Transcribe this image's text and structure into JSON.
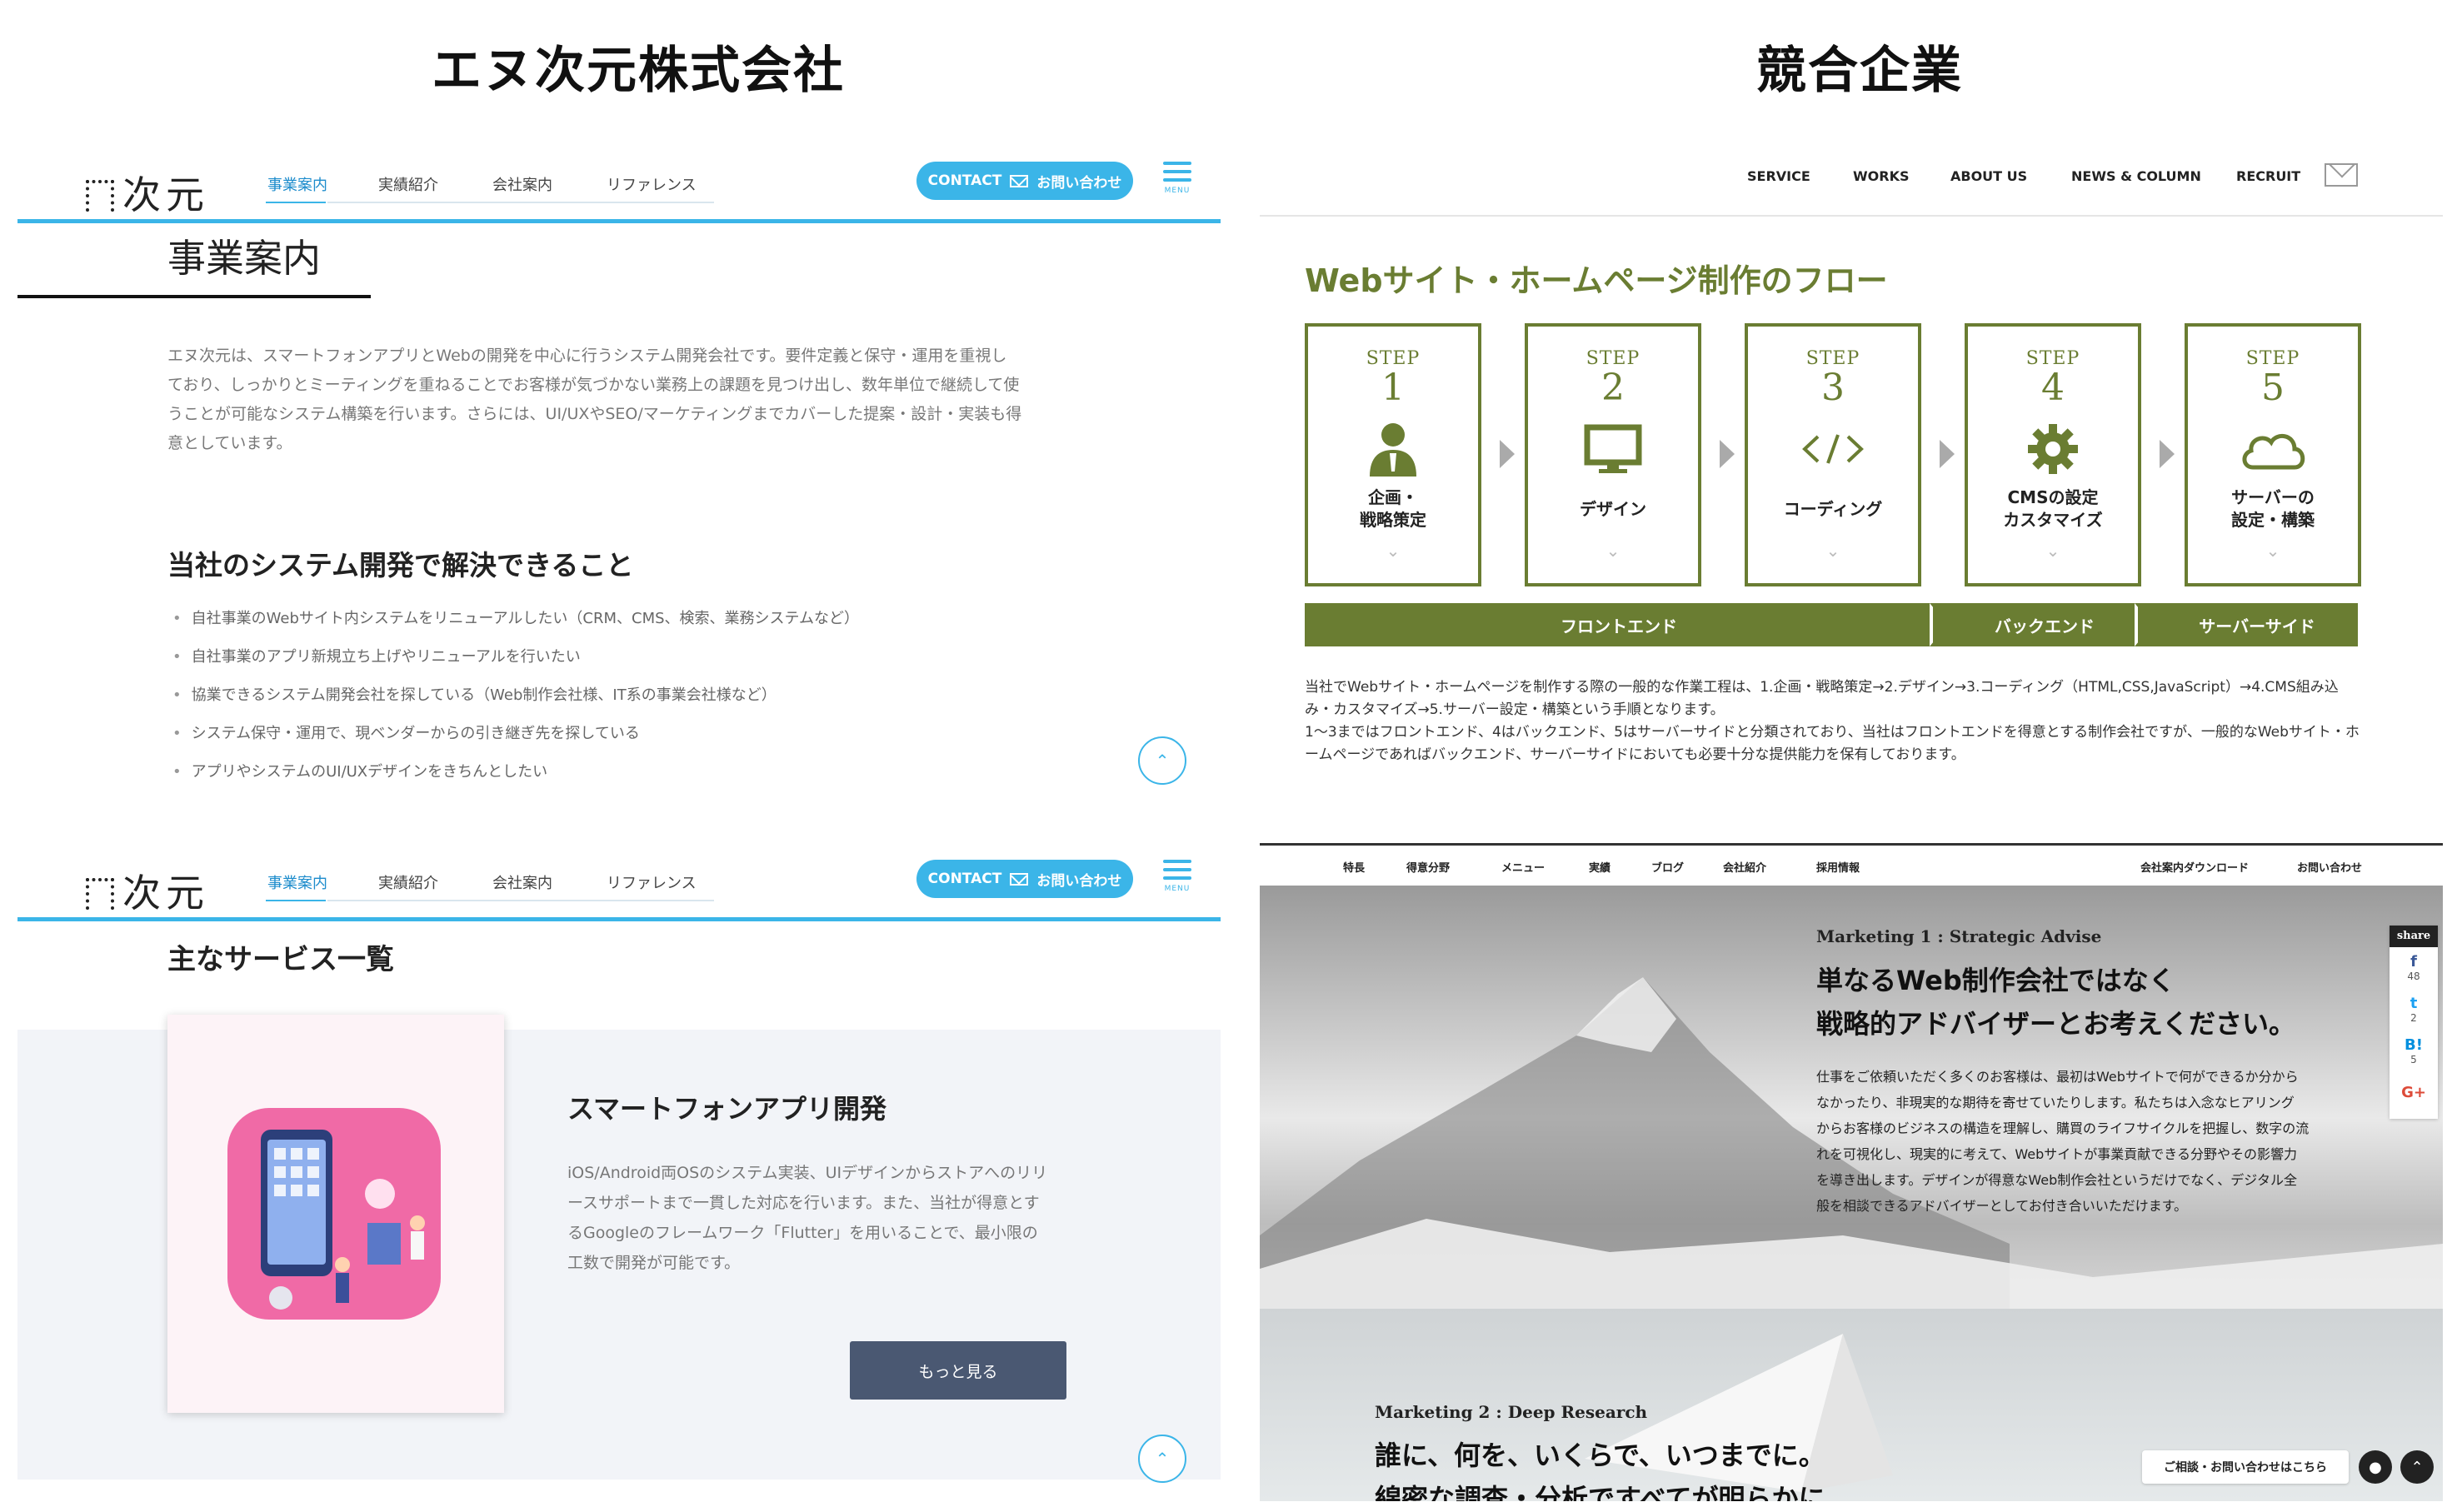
{
  "headings": {
    "left": "エヌ次元株式会社",
    "right": "競合企業"
  },
  "company_site": {
    "logo_text": "次元",
    "nav": [
      "事業案内",
      "実績紹介",
      "会社案内",
      "リファレンス"
    ],
    "contact_label": "CONTACT",
    "contact_jp": "お問い合わせ",
    "menu_label": "MENU",
    "page1": {
      "heading": "事業案内",
      "intro_lines": [
        "エヌ次元は、スマートフォンアプリとWebの開発を中心に行うシステム開発会社です。要件定義と保守・運用を重視し",
        "ており、しっかりとミーティングを重ねることでお客様が気づかない業務上の課題を見つけ出し、数年単位で継続して使",
        "うことが可能なシステム構築を行います。さらには、UI/UXやSEO/マーケティングまでカバーした提案・設計・実装も得",
        "意としています。"
      ],
      "subheading": "当社のシステム開発で解決できること",
      "bullets": [
        "自社事業のWebサイト内システムをリニューアルしたい（CRM、CMS、検索、業務システムなど）",
        "自社事業のアプリ新規立ち上げやリニューアルを行いたい",
        "協業できるシステム開発会社を探している（Web制作会社様、IT系の事業会社様など）",
        "システム保守・運用で、現ベンダーからの引き継ぎ先を探している",
        "アプリやシステムのUI/UXデザインをきちんとしたい"
      ]
    },
    "page2": {
      "heading": "主なサービス一覧",
      "service_title": "スマートフォンアプリ開発",
      "service_lines": [
        "iOS/Android両OSのシステム実装、UIデザインからストアへのリリ",
        "ースサポートまで一貫した対応を行います。また、当社が得意とす",
        "るGoogleのフレームワーク「Flutter」を用いることで、最小限の",
        "工数で開発が可能です。"
      ],
      "more_button": "もっと見る"
    }
  },
  "competitor_flow": {
    "nav": [
      "SERVICE",
      "WORKS",
      "ABOUT US",
      "NEWS & COLUMN",
      "RECRUIT"
    ],
    "title": "Webサイト・ホームページ制作のフロー",
    "step_label": "STEP",
    "steps": [
      {
        "num": "1",
        "line1": "企画・",
        "line2": "戦略策定",
        "icon": "person-icon"
      },
      {
        "num": "2",
        "line1": "デザイン",
        "line2": "",
        "icon": "monitor-icon"
      },
      {
        "num": "3",
        "line1": "コーディング",
        "line2": "",
        "icon": "code-icon"
      },
      {
        "num": "4",
        "line1": "CMSの設定",
        "line2": "カスタマイズ",
        "icon": "gear-icon"
      },
      {
        "num": "5",
        "line1": "サーバーの",
        "line2": "設定・構築",
        "icon": "cloud-icon"
      }
    ],
    "bands": [
      "フロントエンド",
      "バックエンド",
      "サーバーサイド"
    ],
    "desc_lines": [
      "当社でWebサイト・ホームページを制作する際の一般的な作業工程は、1.企画・戦略策定→2.デザイン→3.コーディング（HTML,CSS,JavaScript）→4.CMS組み込",
      "み・カスタマイズ→5.サーバー設定・構築という手順となります。",
      "1〜3まではフロントエンド、4はバックエンド、5はサーバーサイドと分類されており、当社はフロントエンドを得意とする制作会社ですが、一般的なWebサイト・ホ",
      "ームページであればバックエンド、サーバーサイドにおいても必要十分な提供能力を保有しております。"
    ]
  },
  "competitor_marketing": {
    "nav": [
      "特長",
      "得意分野",
      "メニュー",
      "実績",
      "ブログ",
      "会社紹介",
      "採用情報",
      "会社案内ダウンロード",
      "お問い合わせ"
    ],
    "section1_label": "Marketing 1 : Strategic Advise",
    "section1_head_lines": [
      "単なるWeb制作会社ではなく",
      "戦略的アドバイザーとお考えください。"
    ],
    "section1_para_lines": [
      "仕事をご依頼いただく多くのお客様は、最初はWebサイトで何ができるか分から",
      "なかったり、非現実的な期待を寄せていたりします。私たちは入念なヒアリング",
      "からお客様のビジネスの構造を理解し、購買のライフサイクルを把握し、数字の流",
      "れを可視化し、現実的に考えて、Webサイトが事業貢献できる分野やその影響力",
      "を導き出します。デザインが得意なWeb制作会社というだけでなく、デジタル全",
      "般を相談できるアドバイザーとしてお付き合いいただけます。"
    ],
    "section2_label": "Marketing 2 : Deep Research",
    "section2_head": "誰に、何を、いくらで、いつまでに。",
    "section2_cut": "綿密な調査・分析ですべてが明らかに",
    "share": {
      "label": "share",
      "items": [
        {
          "icon": "f",
          "count": "48"
        },
        {
          "icon": "t",
          "count": "2"
        },
        {
          "icon": "B!",
          "count": "5"
        },
        {
          "icon": "G+",
          "count": ""
        }
      ]
    },
    "consult_label": "ご相談・お問い合わせはこちら"
  }
}
